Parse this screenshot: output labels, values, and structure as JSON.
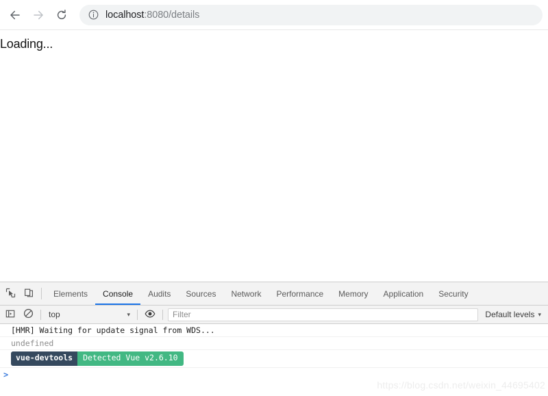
{
  "browser": {
    "nav": {
      "back_label": "Back",
      "forward_label": "Forward",
      "reload_label": "Reload"
    },
    "omnibox": {
      "security_icon": "info-circle-icon",
      "url_host": "localhost",
      "url_rest": ":8080/details",
      "full_url": "localhost:8080/details"
    }
  },
  "page": {
    "body_text": "Loading..."
  },
  "devtools": {
    "tools": {
      "inspect_icon": "inspect-element-icon",
      "device_icon": "device-toolbar-icon"
    },
    "tabs": [
      {
        "label": "Elements",
        "active": false
      },
      {
        "label": "Console",
        "active": true
      },
      {
        "label": "Audits",
        "active": false
      },
      {
        "label": "Sources",
        "active": false
      },
      {
        "label": "Network",
        "active": false
      },
      {
        "label": "Performance",
        "active": false
      },
      {
        "label": "Memory",
        "active": false
      },
      {
        "label": "Application",
        "active": false
      },
      {
        "label": "Security",
        "active": false
      }
    ],
    "filterbar": {
      "sidebar_icon": "console-sidebar-icon",
      "clear_icon": "clear-console-icon",
      "context_value": "top",
      "eye_icon": "live-expression-eye-icon",
      "filter_placeholder": "Filter",
      "filter_value": "",
      "levels_label": "Default levels",
      "caret": "▾"
    },
    "messages": [
      {
        "type": "log",
        "text": "[HMR] Waiting for update signal from WDS..."
      },
      {
        "type": "dim",
        "text": "undefined"
      },
      {
        "type": "badge",
        "badge_left": "vue-devtools",
        "badge_right": "Detected Vue v2.6.10"
      }
    ],
    "prompt": ">"
  },
  "watermark": "https://blog.csdn.net/weixin_44695402",
  "colors": {
    "accent_tab": "#1a73e8",
    "vue_green": "#42b883",
    "vue_navy": "#35495e",
    "prompt_blue": "#3d7ddd",
    "omnibox_bg": "#f1f3f4"
  }
}
